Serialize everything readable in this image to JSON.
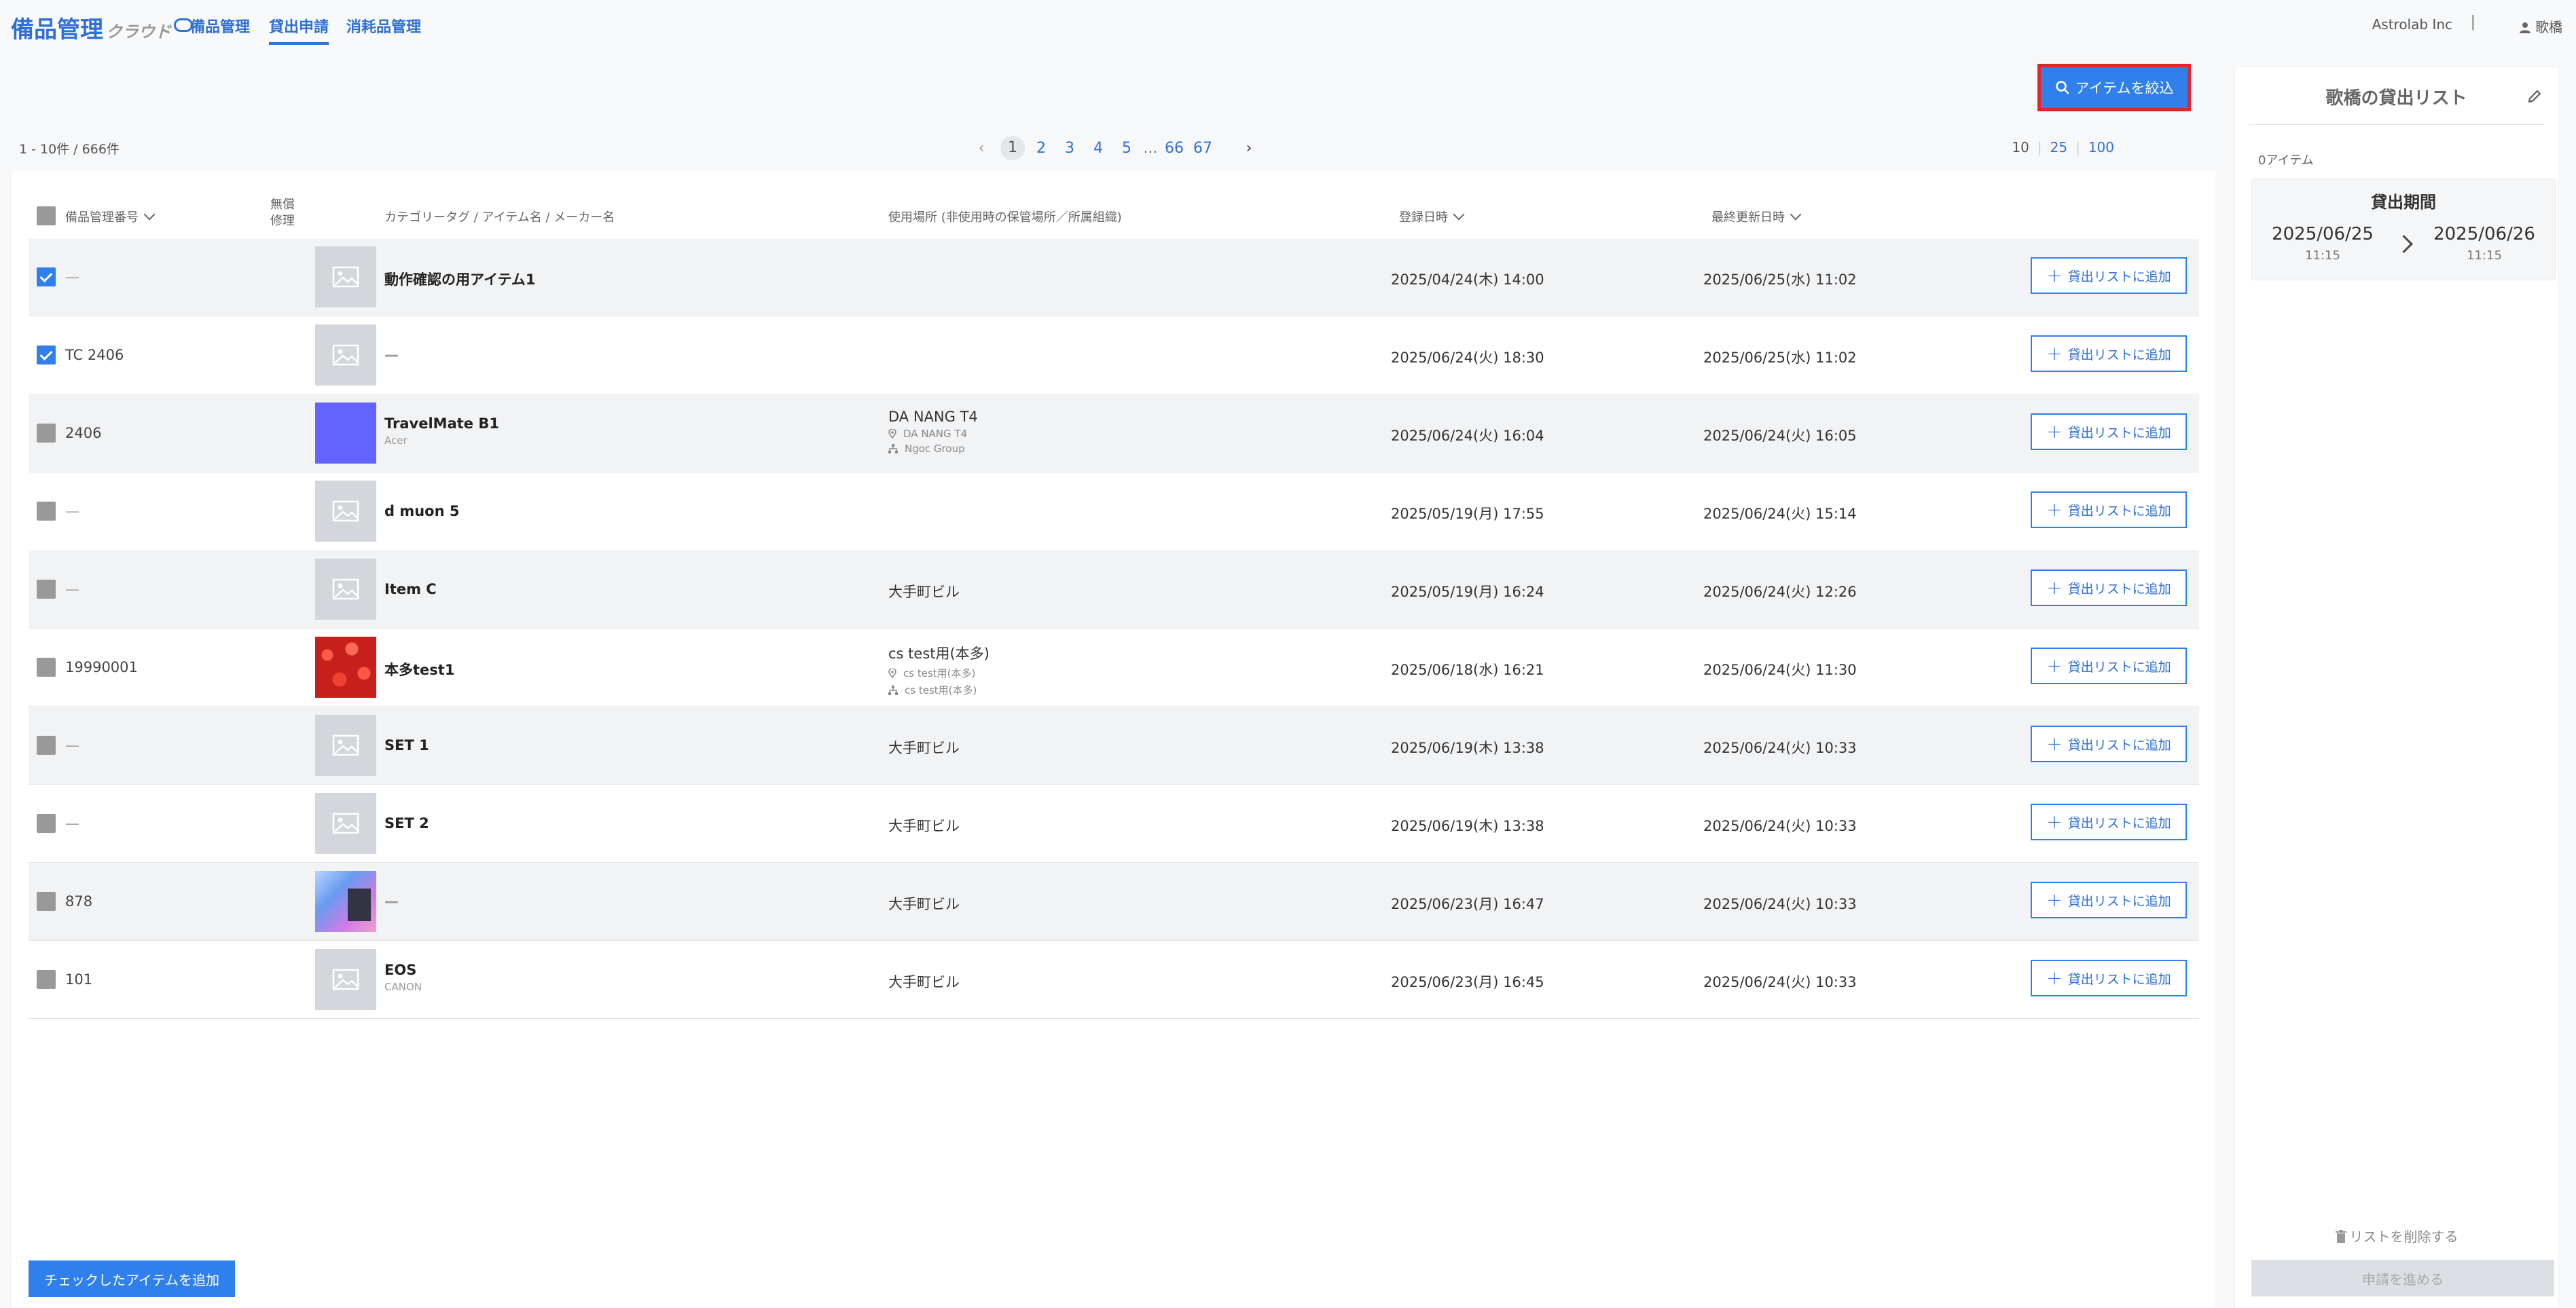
{
  "header": {
    "logo_main": "備品管理",
    "logo_sub": "クラウド",
    "nav": [
      {
        "label": "備品管理"
      },
      {
        "label": "貸出申請"
      },
      {
        "label": "消耗品管理"
      }
    ],
    "tenant": "Astrolab Inc",
    "separator": "|",
    "user": "歌橋"
  },
  "filter_button": "アイテムを絞込",
  "count_text": "1 - 10件 / 666件",
  "pagination": {
    "prev": "‹",
    "pages": [
      "1",
      "2",
      "3",
      "4",
      "5",
      "...",
      "66",
      "67"
    ],
    "next": "›"
  },
  "page_sizes": [
    "10",
    "25",
    "100"
  ],
  "table": {
    "headers": {
      "number": "備品管理番号",
      "repair_1": "無償",
      "repair_2": "修理",
      "item": "カテゴリータグ / アイテム名 / メーカー名",
      "location": "使用場所 (非使用時の保管場所／所属組織)",
      "registered": "登録日時",
      "updated": "最終更新日時"
    },
    "add_label": "貸出リストに追加",
    "rows": [
      {
        "number": "—",
        "name": "動作確認の用アイテム1",
        "maker": "",
        "loc": "",
        "loc_place": "",
        "loc_org": "",
        "registered": "2025/04/24(木) 14:00",
        "updated": "2025/06/25(水) 11:02"
      },
      {
        "number": "TC 2406",
        "name": "—",
        "maker": "",
        "loc": "",
        "loc_place": "",
        "loc_org": "",
        "registered": "2025/06/24(火) 18:30",
        "updated": "2025/06/25(水) 11:02"
      },
      {
        "number": "2406",
        "name": "TravelMate B1",
        "maker": "Acer",
        "loc": "DA NANG T4",
        "loc_place": "DA NANG T4",
        "loc_org": "Ngoc Group",
        "registered": "2025/06/24(火) 16:04",
        "updated": "2025/06/24(火) 16:05"
      },
      {
        "number": "—",
        "name": "d muon 5",
        "maker": "",
        "loc": "",
        "loc_place": "",
        "loc_org": "",
        "registered": "2025/05/19(月) 17:55",
        "updated": "2025/06/24(火) 15:14"
      },
      {
        "number": "—",
        "name": "Item C",
        "maker": "",
        "loc": "大手町ビル",
        "loc_place": "",
        "loc_org": "",
        "registered": "2025/05/19(月) 16:24",
        "updated": "2025/06/24(火) 12:26"
      },
      {
        "number": "19990001",
        "name": "本多test1",
        "maker": "",
        "loc": "cs test用(本多)",
        "loc_place": "cs test用(本多)",
        "loc_org": "cs test用(本多)",
        "registered": "2025/06/18(水) 16:21",
        "updated": "2025/06/24(火) 11:30"
      },
      {
        "number": "—",
        "name": "SET 1",
        "maker": "",
        "loc": "大手町ビル",
        "loc_place": "",
        "loc_org": "",
        "registered": "2025/06/19(木) 13:38",
        "updated": "2025/06/24(火) 10:33"
      },
      {
        "number": "—",
        "name": "SET 2",
        "maker": "",
        "loc": "大手町ビル",
        "loc_place": "",
        "loc_org": "",
        "registered": "2025/06/19(木) 13:38",
        "updated": "2025/06/24(火) 10:33"
      },
      {
        "number": "878",
        "name": "—",
        "maker": "",
        "loc": "大手町ビル",
        "loc_place": "",
        "loc_org": "",
        "registered": "2025/06/23(月) 16:47",
        "updated": "2025/06/24(火) 10:33"
      },
      {
        "number": "101",
        "name": "EOS",
        "maker": "CANON",
        "loc": "大手町ビル",
        "loc_place": "",
        "loc_org": "",
        "registered": "2025/06/23(月) 16:45",
        "updated": "2025/06/24(火) 10:33"
      }
    ]
  },
  "bulk_add": "チェックしたアイテムを追加",
  "sidebar": {
    "title": "歌橋の貸出リスト",
    "items_count": "0アイテム",
    "period_title": "貸出期間",
    "start_date": "2025/06/25",
    "start_time": "11:15",
    "end_date": "2025/06/26",
    "end_time": "11:15",
    "delete_list": "リストを削除する",
    "submit": "申請を進める"
  },
  "colors": {
    "accent": "#2f80ed",
    "highlight_border": "#e0262c"
  }
}
